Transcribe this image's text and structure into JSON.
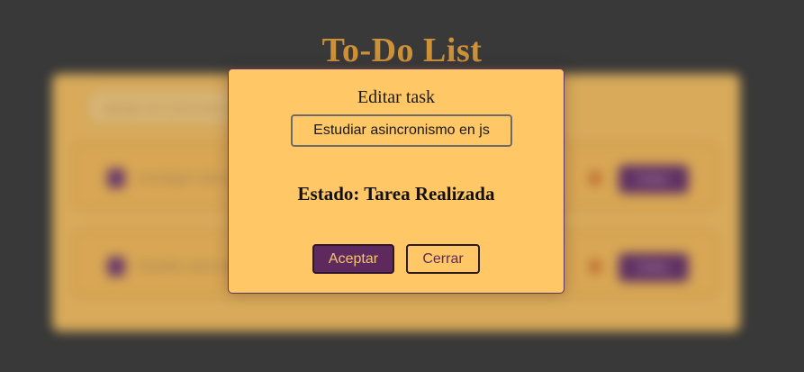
{
  "app": {
    "title": "To-Do List"
  },
  "background": {
    "search_placeholder": "Agrega una nueva tarea",
    "tasks": [
      {
        "label": "Investigar sobre promesas"
      },
      {
        "label": "Estudiar asincronismo en js"
      }
    ],
    "edit_label": "Editar"
  },
  "modal": {
    "title": "Editar task",
    "input_value": "Estudiar asincronismo en js",
    "status_text": "Estado: Tarea Realizada",
    "accept_label": "Aceptar",
    "close_label": "Cerrar"
  },
  "colors": {
    "background": "#3d3d3d",
    "panel": "#ffc766",
    "title": "#f2a93b",
    "accent_purple": "#5e2a5e"
  }
}
